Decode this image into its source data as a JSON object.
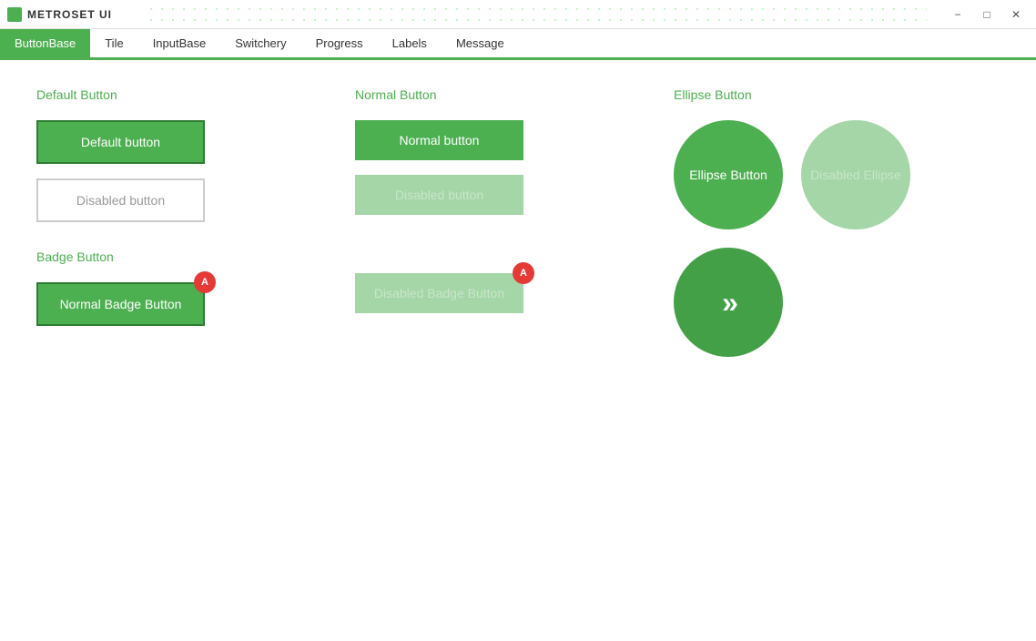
{
  "titlebar": {
    "title": "METROSET UI",
    "minimize_label": "−",
    "maximize_label": "□",
    "close_label": "✕"
  },
  "tabs": [
    {
      "label": "ButtonBase",
      "active": true
    },
    {
      "label": "Tile",
      "active": false
    },
    {
      "label": "InputBase",
      "active": false
    },
    {
      "label": "Switchery",
      "active": false
    },
    {
      "label": "Progress",
      "active": false
    },
    {
      "label": "Labels",
      "active": false
    },
    {
      "label": "Message",
      "active": false
    }
  ],
  "sections": {
    "default_button": {
      "title": "Default Button",
      "default_label": "Default button",
      "disabled_label": "Disabled button"
    },
    "normal_button": {
      "title": "Normal Button",
      "normal_label": "Normal button",
      "disabled_label": "Disabled button"
    },
    "badge_button": {
      "title": "Badge Button",
      "normal_label": "Normal Badge Button",
      "disabled_label": "Disabled Badge Button",
      "badge_normal": "A",
      "badge_disabled": "A"
    },
    "ellipse_button": {
      "title": "Ellipse Button",
      "ellipse_label": "Ellipse Button",
      "disabled_label": "Disabled Ellipse",
      "arrow_icon": "»"
    }
  },
  "colors": {
    "green_active": "#4caf50",
    "green_dark": "#2e7d32",
    "green_disabled": "#a5d6a7",
    "green_disabled_text": "#c8e6c9",
    "red_badge": "#e53935",
    "white": "#ffffff"
  }
}
